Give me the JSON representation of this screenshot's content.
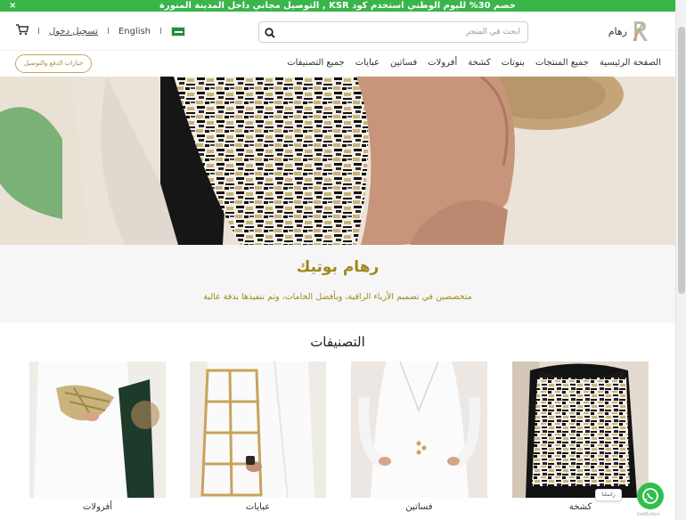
{
  "promo": {
    "text": "خصم 30% لليوم الوطني استخدم كود KSR , التوصيل مجاني داخل المدينة المنورة",
    "close": "×"
  },
  "header": {
    "logo_name": "رهام",
    "search_placeholder": "ابحث في المتجر",
    "language": "English",
    "login": "تسجيل دخول"
  },
  "nav": {
    "items": [
      "الصفحة الرئيسية",
      "جميع المنتجات",
      "بنوتات",
      "كشخة",
      "أفرولات",
      "فساتين",
      "عبايات",
      "جميع التصنيفات"
    ],
    "support_button": "خيارات الدفع والتوصيل"
  },
  "about": {
    "title": "رهام بوتيك",
    "subtitle": "متخصصين في تصميم الأزياء الراقية، وبأفضل الخامات، وتم تنفيذها بدقة عالية"
  },
  "categories": {
    "title": "التصنيفات",
    "items": [
      {
        "label": "كشخة"
      },
      {
        "label": "فساتين"
      },
      {
        "label": "عبايات"
      },
      {
        "label": "أفرولات"
      }
    ]
  },
  "whatsapp": {
    "tip": "راسلنا",
    "brand": "GetButton"
  },
  "colors": {
    "promo_green": "#39b54a",
    "gold": "#9c8a1c",
    "whatsapp": "#2fbf4a"
  }
}
